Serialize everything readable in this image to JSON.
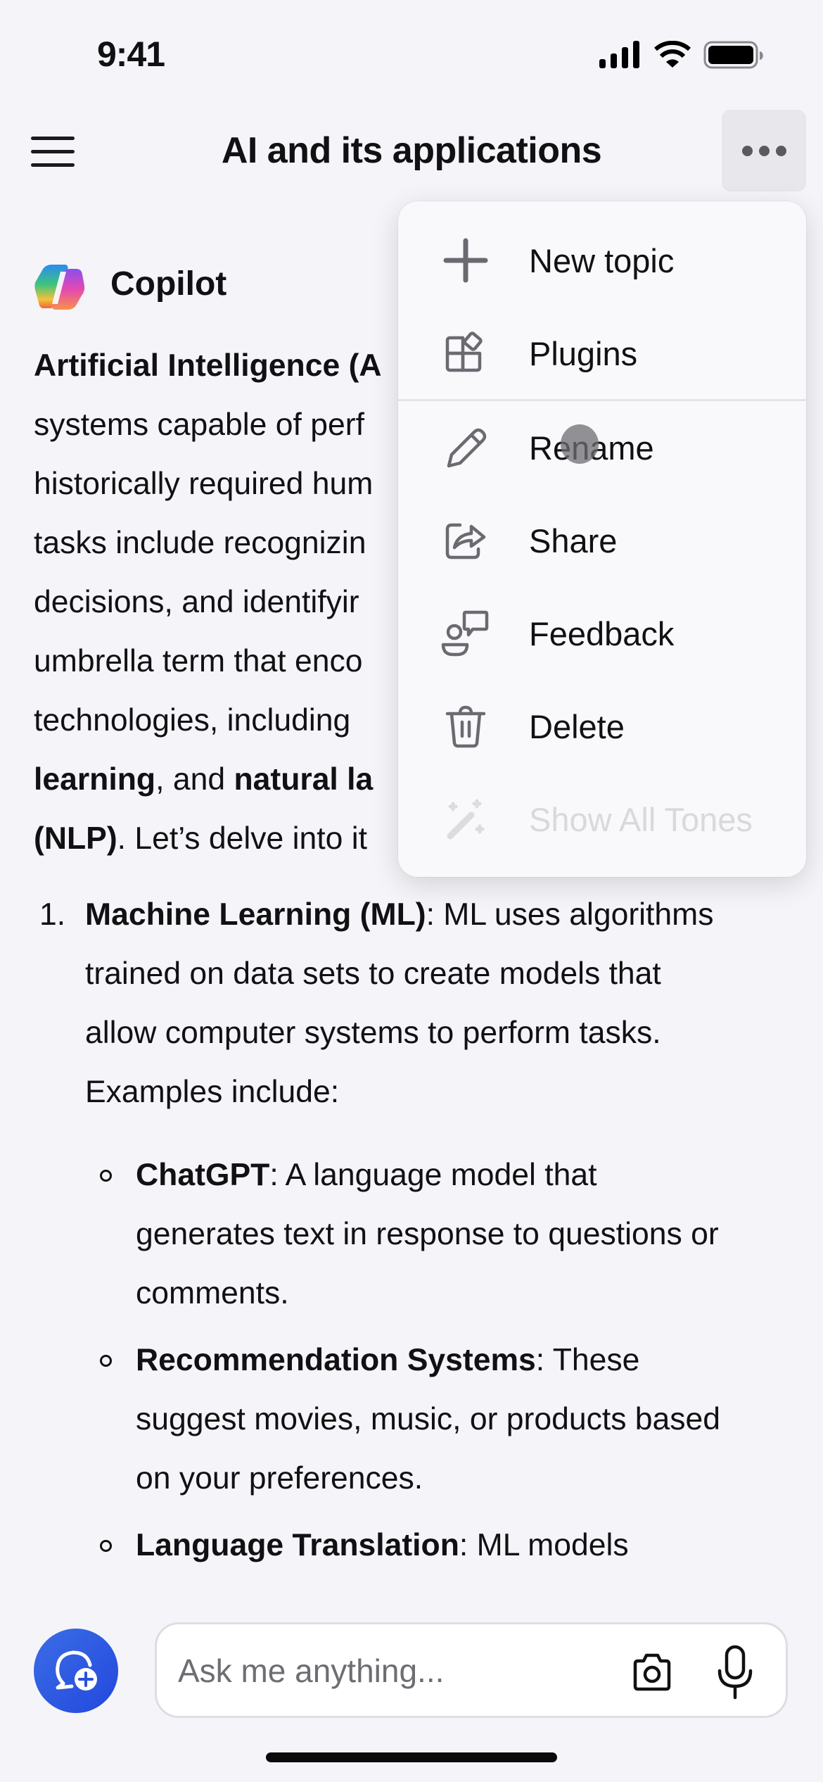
{
  "status_bar": {
    "time": "9:41"
  },
  "nav": {
    "title": "AI and its applications",
    "menu_button_label": "More options"
  },
  "message": {
    "sender": "Copilot",
    "intro_lines": [
      [
        {
          "t": "Artificial Intelligence (A",
          "b": true
        }
      ],
      [
        {
          "t": "systems capable of perf",
          "b": false
        }
      ],
      [
        {
          "t": "historically required hum",
          "b": false
        }
      ],
      [
        {
          "t": "tasks include recognizin",
          "b": false
        }
      ],
      [
        {
          "t": "decisions, and identifyir",
          "b": false
        }
      ],
      [
        {
          "t": "umbrella term that enco",
          "b": false
        }
      ],
      [
        {
          "t": "technologies, including",
          "b": false
        }
      ],
      [
        {
          "t": "learning",
          "b": true
        },
        {
          "t": ", and ",
          "b": false
        },
        {
          "t": "natural la",
          "b": true
        }
      ],
      [
        {
          "t": "(NLP)",
          "b": true
        },
        {
          "t": ". Let’s delve into it",
          "b": false
        }
      ]
    ],
    "list": [
      {
        "number": "1.",
        "lines": [
          [
            {
              "t": "Machine Learning (ML)",
              "b": true
            },
            {
              "t": ": ML uses algorithms",
              "b": false
            }
          ],
          [
            {
              "t": "trained on data sets to create models that",
              "b": false
            }
          ],
          [
            {
              "t": "allow computer systems to perform tasks.",
              "b": false
            }
          ],
          [
            {
              "t": "Examples include:",
              "b": false
            }
          ]
        ],
        "sub_items": [
          {
            "lines": [
              [
                {
                  "t": "ChatGPT",
                  "b": true
                },
                {
                  "t": ": A language model that",
                  "b": false
                }
              ],
              [
                {
                  "t": "generates text in response to questions or",
                  "b": false
                }
              ],
              [
                {
                  "t": "comments.",
                  "b": false
                }
              ]
            ]
          },
          {
            "lines": [
              [
                {
                  "t": "Recommendation Systems",
                  "b": true
                },
                {
                  "t": ": These",
                  "b": false
                }
              ],
              [
                {
                  "t": "suggest movies, music, or products based",
                  "b": false
                }
              ],
              [
                {
                  "t": "on your preferences.",
                  "b": false
                }
              ]
            ]
          },
          {
            "lines": [
              [
                {
                  "t": "Language Translation",
                  "b": true
                },
                {
                  "t": ": ML models",
                  "b": false
                }
              ]
            ]
          }
        ]
      }
    ]
  },
  "menu": {
    "items": [
      {
        "label": "New topic",
        "icon": "plus-icon",
        "enabled": true
      },
      {
        "label": "Plugins",
        "icon": "plugins-icon",
        "enabled": true
      },
      {
        "label": "Rename",
        "icon": "pencil-icon",
        "enabled": true
      },
      {
        "label": "Share",
        "icon": "share-icon",
        "enabled": true
      },
      {
        "label": "Feedback",
        "icon": "feedback-icon",
        "enabled": true
      },
      {
        "label": "Delete",
        "icon": "trash-icon",
        "enabled": true
      },
      {
        "label": "Show All Tones",
        "icon": "magic-wand-icon",
        "enabled": false
      }
    ]
  },
  "composer": {
    "placeholder": "Ask me anything...",
    "value": ""
  },
  "colors": {
    "background": "#f5f4f8",
    "accent": "#2b55e0",
    "menu_background": "#f9f8fb",
    "icon_gray": "#6b6a70",
    "disabled_text": "#d9d8dc"
  }
}
